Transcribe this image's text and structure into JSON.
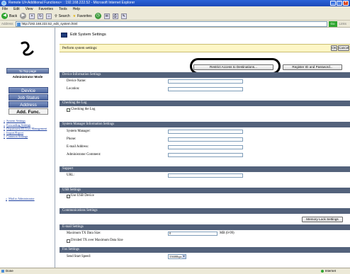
{
  "window": {
    "title": "Remote UI<Additional Functions>: : 192.168.222.52 - Microsoft Internet Explorer"
  },
  "menu": [
    "File",
    "Edit",
    "View",
    "Favorites",
    "Tools",
    "Help"
  ],
  "toolbar": {
    "back": "Back",
    "search": "Search",
    "favorites": "Favorites"
  },
  "address": {
    "label": "Address",
    "url": "http://192.168.222.52_edit_system.html",
    "go": "Go",
    "links": "Links"
  },
  "sidebar": {
    "top_page": "To Top page",
    "mode": "Administrator Mode",
    "nav": [
      "Device",
      "Job Status",
      "Address",
      "Add. Func."
    ],
    "links": [
      {
        "bullet": "»",
        "label": "System Settings"
      },
      {
        "bullet": "»",
        "label": "Forwarding Settings"
      },
      {
        "bullet": "»",
        "label": "Department ID/User Management"
      },
      {
        "bullet": "»",
        "label": "Import/Export"
      },
      {
        "bullet": "»",
        "label": "Common Settings"
      }
    ],
    "mail": {
      "bullet": "»",
      "label": "Mail to Administrator"
    }
  },
  "page": {
    "title": "Edit System Settings",
    "perform_label": "Perform system settings:",
    "ok": "OK",
    "cancel": "Cancel",
    "restrict": "Restrict Access to Destinations...",
    "register": "Register ID and Password..."
  },
  "sections": {
    "device_info": "Device Information Settings",
    "device_name": "Device Name:",
    "location": "Location:",
    "checking_log": "Checking the Log",
    "checking_log_cb": "Checking the Log",
    "system_manager": "System Manager Information Settings",
    "sys_mgr": "System Manager:",
    "phone": "Phone:",
    "email": "E-mail Address:",
    "admin_comment": "Administrator Comment:",
    "support": "Support",
    "url": "URL:",
    "usb": "USB Settings",
    "use_usb": "Use USB Device",
    "comm": "Communications Settings",
    "memory_lock": "Memory Lock Settings",
    "email_settings": "E-mail Settings",
    "max_tx": "Maximum TX Data Size:",
    "max_tx_value": "0",
    "max_tx_unit": "MB (0-99)",
    "divided_tx": "Divided TX over Maximum Data Size",
    "fax": "Fax Settings",
    "send_speed": "Send Start Speed:",
    "send_speed_value": "33600bps"
  },
  "status": {
    "left": "Done",
    "zone": "Internet"
  }
}
